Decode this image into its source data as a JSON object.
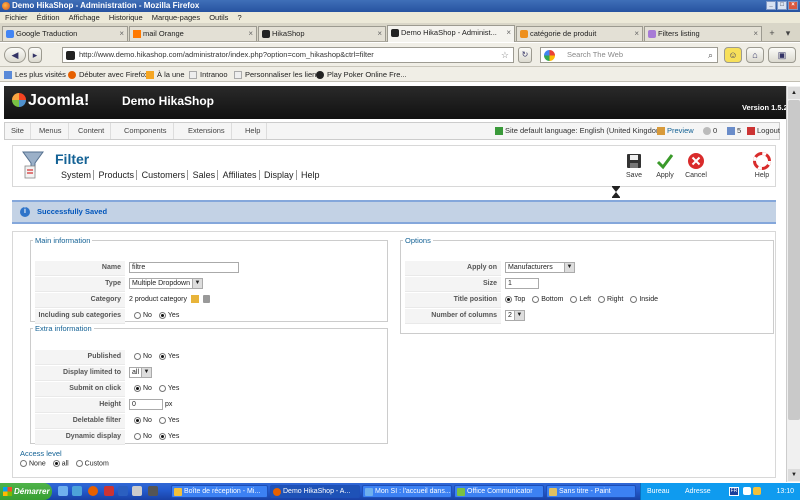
{
  "window": {
    "title": "Demo HikaShop - Administration - Mozilla Firefox"
  },
  "menubar": [
    "Fichier",
    "Édition",
    "Affichage",
    "Historique",
    "Marque-pages",
    "Outils",
    "?"
  ],
  "tabs": [
    {
      "label": "Google Traduction",
      "close": "×"
    },
    {
      "label": "mail Orange",
      "close": "×"
    },
    {
      "label": "HikaShop",
      "close": "×"
    },
    {
      "label": "Demo HikaShop - Administ...",
      "close": "×"
    },
    {
      "label": "catégorie de produit",
      "close": "×"
    },
    {
      "label": "Filters listing",
      "close": "×"
    }
  ],
  "address": {
    "url": "http://www.demo.hikashop.com/administrator/index.php?option=com_hikashop&ctrl=filter",
    "search_placeholder": "Search The Web"
  },
  "bookmarks": [
    "Les plus visités",
    "Débuter avec Firefox",
    "À la une",
    "Intranoo",
    "Personnaliser les liens",
    "Play Poker Online Fre..."
  ],
  "header": {
    "logo": "Joomla!",
    "site_name": "Demo HikaShop",
    "version": "Version 1.5.23"
  },
  "admin_menu": [
    "Site",
    "Menus",
    "Content",
    "Components",
    "Extensions",
    "Help"
  ],
  "admin_status": {
    "language": "Site default language: English (United Kingdom)",
    "preview": "Preview",
    "messages": "0",
    "users": "5",
    "logout": "Logout"
  },
  "page": {
    "title": "Filter",
    "subnav": [
      "System",
      "Products",
      "Customers",
      "Sales",
      "Affiliates",
      "Display",
      "Help"
    ],
    "toolbar": [
      "Save",
      "Apply",
      "Cancel",
      "Help"
    ]
  },
  "message": "Successfully Saved",
  "main_info": {
    "legend": "Main information",
    "name_label": "Name",
    "name_value": "filtre",
    "type_label": "Type",
    "type_value": "Multiple Dropdown",
    "category_label": "Category",
    "category_value": "2 product category",
    "subcat_label": "Including sub categories",
    "subcat_no": "No",
    "subcat_yes": "Yes"
  },
  "extra_info": {
    "legend": "Extra information",
    "published_label": "Published",
    "published_no": "No",
    "published_yes": "Yes",
    "display_label": "Display limited to",
    "display_value": "all",
    "submit_label": "Submit on click",
    "submit_no": "No",
    "submit_yes": "Yes",
    "height_label": "Height",
    "height_value": "0",
    "height_unit": "px",
    "deletable_label": "Deletable filter",
    "deletable_no": "No",
    "deletable_yes": "Yes",
    "dynamic_label": "Dynamic display",
    "dynamic_no": "No",
    "dynamic_yes": "Yes"
  },
  "access": {
    "label": "Access level",
    "none": "None",
    "all": "all",
    "custom": "Custom"
  },
  "options": {
    "legend": "Options",
    "apply_label": "Apply on",
    "apply_value": "Manufacturers",
    "size_label": "Size",
    "size_value": "1",
    "title_pos_label": "Title position",
    "top": "Top",
    "bottom": "Bottom",
    "left": "Left",
    "right": "Right",
    "inside": "Inside",
    "columns_label": "Number of columns",
    "columns_value": "2"
  },
  "taskbar": {
    "start": "Démarrer",
    "tasks": [
      "Boîte de réception - Mi...",
      "Demo HikaShop - A...",
      "Mon SI : l'accueil dans...",
      "Office Communicator",
      "Sans titre - Paint"
    ],
    "tray_left": "Bureau",
    "tray_mid": "Adresse",
    "lang": "FR",
    "clock": "13:10"
  },
  "colors": {
    "joomla_header": "#1a1a1a",
    "title_blue": "#146295",
    "message_bg": "#c3d2e5",
    "taskbar": "#245cd0"
  }
}
